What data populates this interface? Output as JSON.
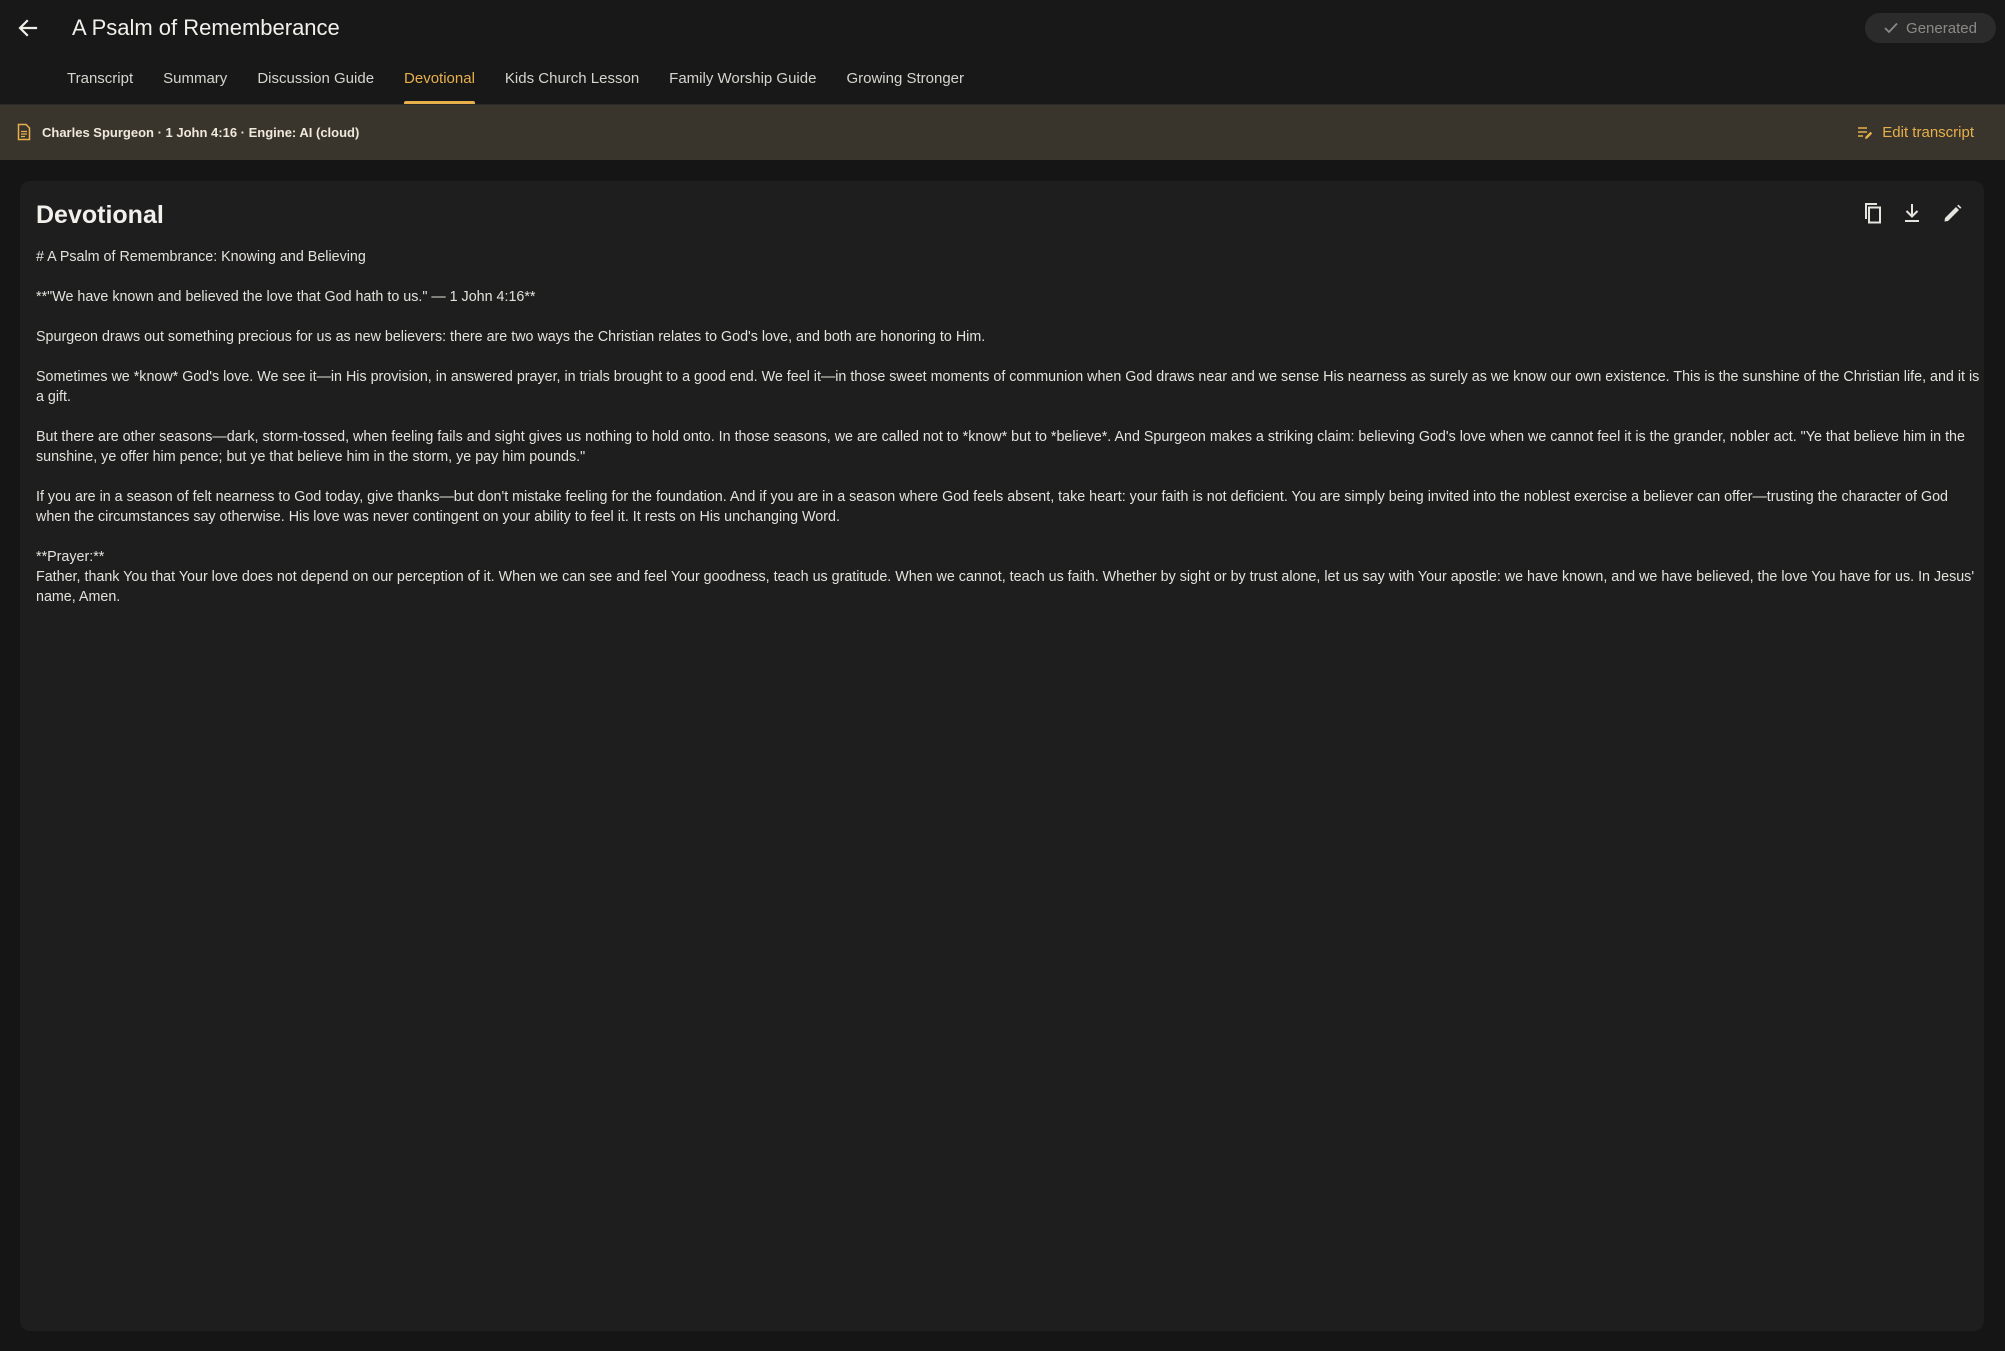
{
  "header": {
    "title": "A Psalm of Rememberance",
    "status": "Generated"
  },
  "tabs": [
    {
      "label": "Transcript",
      "active": false
    },
    {
      "label": "Summary",
      "active": false
    },
    {
      "label": "Discussion Guide",
      "active": false
    },
    {
      "label": "Devotional",
      "active": true
    },
    {
      "label": "Kids Church Lesson",
      "active": false
    },
    {
      "label": "Family Worship Guide",
      "active": false
    },
    {
      "label": "Growing Stronger",
      "active": false
    }
  ],
  "info_bar": {
    "text": "Charles Spurgeon · 1 John 4:16 · Engine: AI (cloud)",
    "edit_label": "Edit transcript"
  },
  "card": {
    "title": "Devotional",
    "paragraphs": [
      "# A Psalm of Remembrance: Knowing and Believing",
      "**\"We have known and believed the love that God hath to us.\" — 1 John 4:16**",
      "Spurgeon draws out something precious for us as new believers: there are two ways the Christian relates to God's love, and both are honoring to Him.",
      "Sometimes we *know* God's love. We see it—in His provision, in answered prayer, in trials brought to a good end. We feel it—in those sweet moments of communion when God draws near and we sense His nearness as surely as we know our own existence. This is the sunshine of the Christian life, and it is a gift.",
      "But there are other seasons—dark, storm-tossed, when feeling fails and sight gives us nothing to hold onto. In those seasons, we are called not to *know* but to *believe*. And Spurgeon makes a striking claim: believing God's love when we cannot feel it is the grander, nobler act. \"Ye that believe him in the sunshine, ye offer him pence; but ye that believe him in the storm, ye pay him pounds.\"",
      "If you are in a season of felt nearness to God today, give thanks—but don't mistake feeling for the foundation. And if you are in a season where God feels absent, take heart: your faith is not deficient. You are simply being invited into the noblest exercise a believer can offer—trusting the character of God when the circumstances say otherwise. His love was never contingent on your ability to feel it. It rests on His unchanging Word.",
      "**Prayer:**",
      "Father, thank You that Your love does not depend on our perception of it. When we can see and feel Your goodness, teach us gratitude. When we cannot, teach us faith. Whether by sight or by trust alone, let us say with Your apostle: we have known, and we have believed, the love You have for us. In Jesus' name, Amen."
    ]
  },
  "colors": {
    "accent": "#e7b04b",
    "background": "#151515",
    "card": "#1e1e1e",
    "info_bar": "#3a352c"
  },
  "icons": {
    "back": "arrow-left-icon",
    "status": "check-icon",
    "info": "document-icon",
    "edit_transcript": "edit-note-icon",
    "copy": "copy-icon",
    "download": "download-icon",
    "edit": "pencil-icon"
  }
}
